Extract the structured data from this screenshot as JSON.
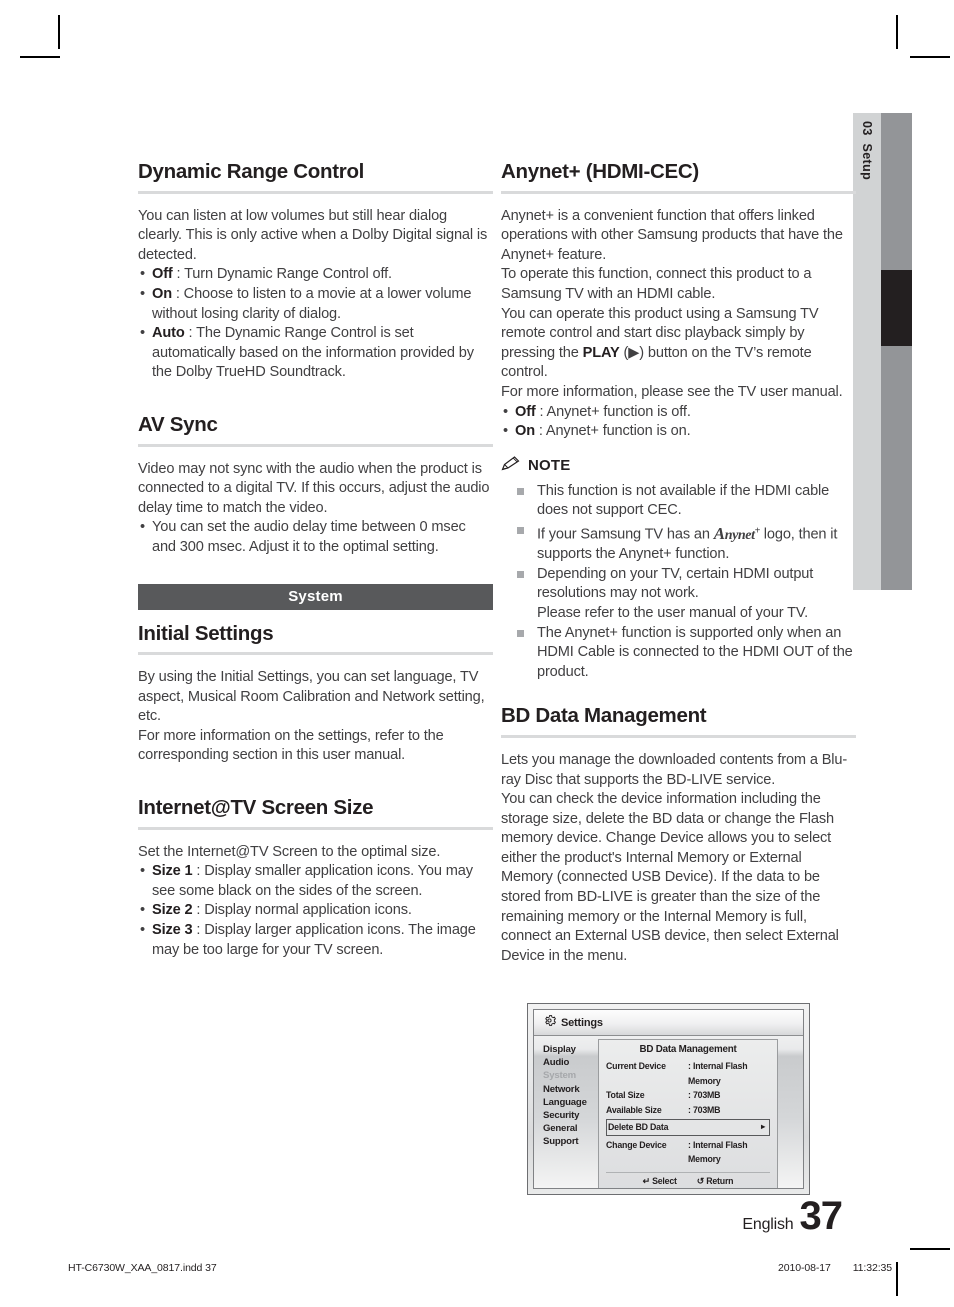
{
  "side_tab": {
    "chapter_number": "03",
    "chapter_label": "Setup"
  },
  "left_column": {
    "sections": [
      {
        "heading": "Dynamic Range Control",
        "paragraphs": [
          "You can listen at low volumes but still hear dialog clearly. This is only active when a Dolby Digital signal is detected."
        ],
        "bullets": [
          {
            "term": "Off",
            "text": ": Turn Dynamic Range Control off."
          },
          {
            "term": "On",
            "text": ": Choose to listen to a movie at a lower volume without losing clarity of dialog."
          },
          {
            "term": "Auto",
            "text": ": The Dynamic Range Control is set automatically based on the information provided by the Dolby TrueHD Soundtrack."
          }
        ]
      },
      {
        "heading": "AV Sync",
        "paragraphs": [
          "Video may not sync with the audio when the product is connected to a digital TV. If this occurs, adjust the audio delay time to match the video."
        ],
        "bullets": [
          {
            "term": "",
            "text": "You can set the audio delay time between 0 msec and 300 msec. Adjust it to the optimal setting."
          }
        ]
      }
    ],
    "band_label": "System",
    "sections_after_band": [
      {
        "heading": "Initial Settings",
        "paragraphs": [
          "By using the Initial Settings, you can set language, TV aspect, Musical Room Calibration and Network setting, etc.",
          "For more information on the settings, refer to the corresponding section in this user manual."
        ],
        "bullets": []
      },
      {
        "heading": "Internet@TV Screen Size",
        "paragraphs": [
          "Set the Internet@TV Screen to the optimal size."
        ],
        "bullets": [
          {
            "term": "Size 1",
            "text": ": Display smaller application icons. You may see some black on the sides of the screen."
          },
          {
            "term": "Size 2",
            "text": ": Display normal application icons."
          },
          {
            "term": "Size 3",
            "text": ": Display larger application icons. The image may be too large for your TV screen."
          }
        ]
      }
    ]
  },
  "right_column": {
    "anynet": {
      "heading": "Anynet+ (HDMI-CEC)",
      "paragraphs": [
        "Anynet+ is a convenient function that offers linked operations with other Samsung products that have the Anynet+ feature.",
        "To operate this function, connect this product to a Samsung TV with an HDMI cable.",
        "You can operate this product using a Samsung TV remote control and start disc playback simply by pressing the PLAY (▶) button on the TV’s remote control.",
        "For more information, please see the TV user manual."
      ],
      "play_keyword": "PLAY",
      "bullets": [
        {
          "term": "Off",
          "text": ": Anynet+ function is off."
        },
        {
          "term": "On",
          "text": ": Anynet+ function is on."
        }
      ]
    },
    "note": {
      "label": "NOTE",
      "items": [
        {
          "pre": "This function is not available if the HDMI cable does not support CEC.",
          "logo": "",
          "post": ""
        },
        {
          "pre": "If your Samsung TV has an ",
          "logo": "Anynet+",
          "post": " logo, then it supports the Anynet+ function."
        },
        {
          "pre": "Depending on your TV, certain HDMI output resolutions may not work.\nPlease refer to the user manual of your TV.",
          "logo": "",
          "post": ""
        },
        {
          "pre": "The Anynet+ function is supported only when an HDMI Cable is connected to the HDMI OUT of the product.",
          "logo": "",
          "post": ""
        }
      ]
    },
    "bd_data": {
      "heading": "BD Data Management",
      "paragraphs": [
        "Lets you manage the downloaded contents from a Blu-ray Disc that supports the BD-LIVE service.",
        "You can check the device information including the storage size, delete the BD data or change the Flash memory device. Change Device allows you to select either the product's Internal Memory or External Memory (connected USB Device). If the data to be stored from BD-LIVE is greater than the size of the remaining memory or the Internal Memory is full, connect an External USB device, then select External Device in the menu."
      ]
    }
  },
  "tv_screenshot": {
    "title": "Settings",
    "menu_items": [
      {
        "label": "Display",
        "active": false
      },
      {
        "label": "Audio",
        "active": false
      },
      {
        "label": "System",
        "active": true
      },
      {
        "label": "Network",
        "active": false
      },
      {
        "label": "Language",
        "active": false
      },
      {
        "label": "Security",
        "active": false
      },
      {
        "label": "General",
        "active": false
      },
      {
        "label": "Support",
        "active": false
      }
    ],
    "panel_title": "BD Data Management",
    "rows": [
      {
        "key": "Current Device",
        "value": ": Internal Flash Memory",
        "selected": false
      },
      {
        "key": "Total Size",
        "value": ": 703MB",
        "selected": false
      },
      {
        "key": "Available Size",
        "value": ": 703MB",
        "selected": false
      }
    ],
    "selected_row": {
      "key": "Delete BD Data",
      "value": "",
      "arrow": "▸"
    },
    "last_row": {
      "key": "Change Device",
      "value": ": Internal Flash Memory"
    },
    "footer": [
      {
        "icon": "↵",
        "label": "Select"
      },
      {
        "icon": "↺",
        "label": "Return"
      }
    ]
  },
  "footer": {
    "language": "English",
    "page_number": "37",
    "print_file": "HT-C6730W_XAA_0817.indd   37",
    "print_date": "2010-08-17",
    "print_time": "11:32:35"
  }
}
